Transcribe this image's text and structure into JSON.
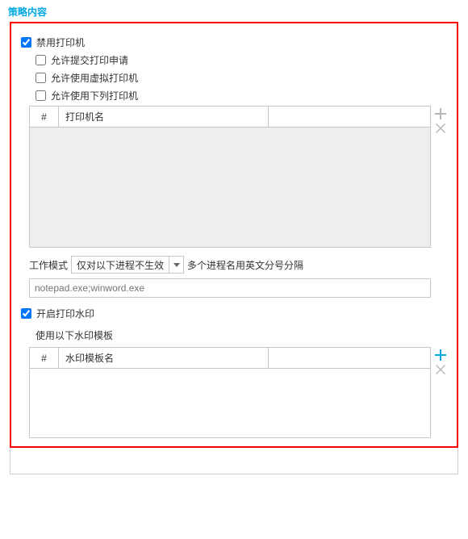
{
  "section_title": "策略内容",
  "disable_printer": {
    "label": "禁用打印机",
    "checked": true,
    "allow_submit": {
      "label": "允许提交打印申请",
      "checked": false
    },
    "allow_virtual": {
      "label": "允许使用虚拟打印机",
      "checked": false
    },
    "allow_list": {
      "label": "允许使用下列打印机",
      "checked": false
    },
    "table": {
      "col_idx": "#",
      "col_name": "打印机名"
    },
    "work_mode_label": "工作模式",
    "work_mode_value": "仅对以下进程不生效",
    "work_mode_hint": "多个进程名用英文分号分隔",
    "process_placeholder": "notepad.exe;winword.exe"
  },
  "watermark": {
    "label": "开启打印水印",
    "checked": true,
    "template_label": "使用以下水印模板",
    "table": {
      "col_idx": "#",
      "col_name": "水印模板名"
    }
  },
  "icons": {
    "add_grey": "#b7b7b7",
    "add_blue": "#00a8e6",
    "remove": "#b7b7b7"
  }
}
